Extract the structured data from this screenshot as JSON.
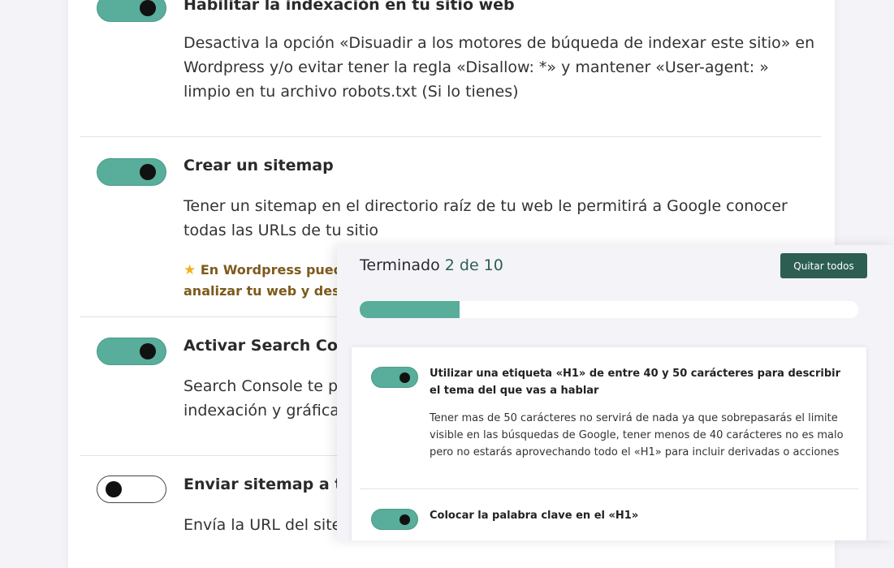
{
  "checklist": {
    "items": [
      {
        "title": "Habilitar la indexación en tu sitio web",
        "description": "Desactiva la opción «Disuadir a los motores de búqueda de indexar este sitio» en Wordpress y/o evitar tener la regla «Disallow: *» y mantener «User-agent: » limpio en tu archivo robots.txt (Si lo tienes)",
        "checked": true
      },
      {
        "title": "Crear un sitemap",
        "description": "Tener un sitemap en el directorio raíz de tu web le permitirá a Google conocer todas las URLs de tu sitio",
        "tip_line1": "En Wordpress pued",
        "tip_line2": "analizar tu web y desca",
        "checked": true
      },
      {
        "title": "Activar Search Con",
        "description_line1": "Search Console te p",
        "description_line2": "indexación y gráficas",
        "checked": true
      },
      {
        "title": "Enviar sitemap a tr",
        "description": "Envía la URL del site",
        "checked": false
      }
    ]
  },
  "progress_panel": {
    "label": "Terminado",
    "count": "2 de 10",
    "completed": 2,
    "total": 10,
    "quit_button": "Quitar todos",
    "items": [
      {
        "title": "Utilizar una etiqueta «H1» de entre 40 y 50 carácteres para describir el tema del que vas a hablar",
        "description": "Tener mas de 50 carácteres no servirá de nada ya que sobrepasarás el limite visible en las búsquedas de Google, tener menos de 40 carácteres no es malo pero no estarás aprovechando todo el «H1» para incluir derivadas o acciones",
        "checked": true
      },
      {
        "title": "Colocar la palabra clave en el «H1»",
        "checked": true
      }
    ]
  },
  "colors": {
    "accent": "#58ae9a",
    "button": "#2c5e52",
    "tip": "#7d5a1c"
  }
}
